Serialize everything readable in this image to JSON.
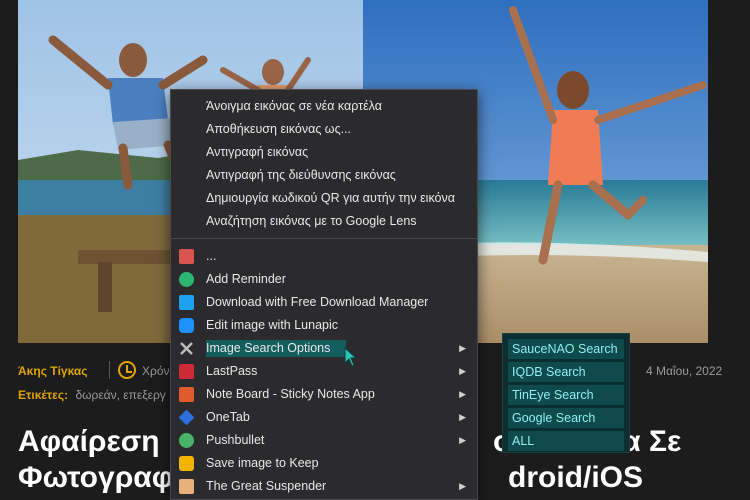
{
  "article": {
    "author": "Άκης Τίγκας",
    "time_label": "Χρόνος",
    "date": "4 Μαΐου, 2022",
    "tags_label": "Ετικέτες:",
    "tags": "δωρεάν,  επεξεργ",
    "headline_line1_left": "Αφαίρεση",
    "headline_line1_right": "ον Σκουλα Σε",
    "headline_line2_left": "Φωτογραφ",
    "headline_line2_right": "droid/iOS"
  },
  "context_menu": {
    "browser_items": [
      "Άνοιγμα εικόνας σε νέα καρτέλα",
      "Αποθήκευση εικόνας ως...",
      "Αντιγραφή εικόνας",
      "Αντιγραφή της διεύθυνσης εικόνας",
      "Δημιουργία κωδικού QR για αυτήν την εικόνα",
      "Αναζήτηση εικόνας με το Google Lens"
    ],
    "extension_items": [
      {
        "label": "...",
        "icon": "mail-reminder-icon",
        "color": "#d9534f",
        "has_submenu": false
      },
      {
        "label": "Add Reminder",
        "icon": "alarm-clock-icon",
        "color": "#2bb673",
        "has_submenu": false
      },
      {
        "label": "Download with Free Download Manager",
        "icon": "download-icon",
        "color": "#1da1f2",
        "has_submenu": false
      },
      {
        "label": "Edit image with Lunapic",
        "icon": "moon-icon",
        "color": "#1e90ff",
        "has_submenu": false
      },
      {
        "label": "Image Search Options",
        "icon": "image-search-icon",
        "color": "#555555",
        "has_submenu": true,
        "highlighted": true
      },
      {
        "label": "LastPass",
        "icon": "lastpass-icon",
        "color": "#cc2a36",
        "has_submenu": true
      },
      {
        "label": "Note Board - Sticky Notes App",
        "icon": "sticky-note-icon",
        "color": "#e05b2b",
        "has_submenu": true
      },
      {
        "label": "OneTab",
        "icon": "onetab-icon",
        "color": "#2d6fdb",
        "has_submenu": true
      },
      {
        "label": "Pushbullet",
        "icon": "pushbullet-icon",
        "color": "#4ab367",
        "has_submenu": true
      },
      {
        "label": "Save image to Keep",
        "icon": "keep-icon",
        "color": "#f4b400",
        "has_submenu": false
      },
      {
        "label": "The Great Suspender",
        "icon": "suspender-icon",
        "color": "#e8b07a",
        "has_submenu": true
      }
    ],
    "arrow": "▶"
  },
  "submenu": {
    "items": [
      "SauceNAO Search",
      "IQDB Search",
      "TinEye Search",
      "Google Search",
      "ALL"
    ]
  }
}
